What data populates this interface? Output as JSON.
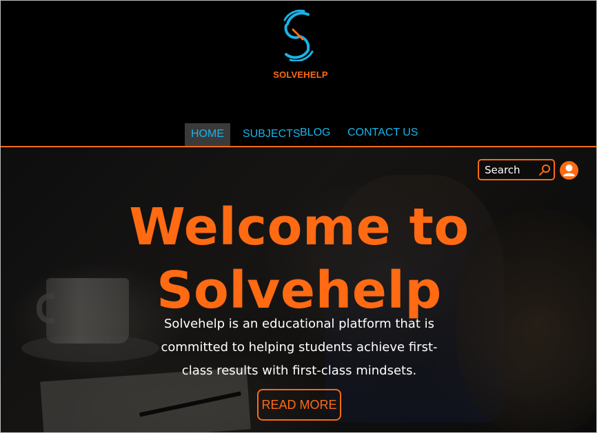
{
  "brand": {
    "name": "SOLVEHELP",
    "logo_icon": "s-circle-logo-icon"
  },
  "nav": {
    "items": [
      {
        "label": "HOME",
        "active": true
      },
      {
        "label": "SUBJECTS",
        "active": false
      },
      {
        "label": "BLOG",
        "active": false
      },
      {
        "label": "CONTACT US",
        "active": false
      }
    ]
  },
  "search": {
    "placeholder": "Search",
    "icon": "search-icon"
  },
  "user": {
    "icon": "user-icon"
  },
  "hero": {
    "title_line1": "Welcome to",
    "title_line2": "Solvehelp",
    "tagline": "Solvehelp is an educational platform that is committed to helping students achieve first-class results with first-class mindsets.",
    "cta_label": "READ MORE"
  },
  "colors": {
    "accent": "#ff6a13",
    "nav_text": "#19b4e8",
    "nav_active_bg": "#3a3a3a",
    "background": "#000000"
  }
}
